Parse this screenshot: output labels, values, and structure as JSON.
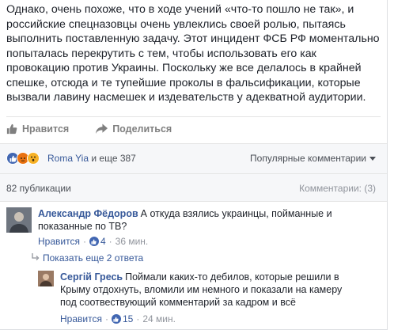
{
  "post": {
    "text": "Однако, очень похоже, что в ходе учений «что-то пошло не так», и российские спецназовцы очень увлеклись своей ролью, пытаясь выполнить поставленную задачу. Этот инцидент ФСБ РФ моментально попыталась перекрутить с тем, чтобы использовать его как провокацию против Украины. Поскольку же все делалось в крайней спешке, отсюда и те тупейшие проколы в фальсификации, которые вызвали лавину насмешек и издевательств у адекватной аудитории."
  },
  "actions": {
    "like_label": "Нравится",
    "share_label": "Поделиться"
  },
  "reactions": {
    "icons": [
      "like",
      "angry",
      "wow"
    ],
    "names_first": "Roma Yia",
    "names_rest": " и еще 387",
    "sort_label": "Популярные комментарии"
  },
  "comments_header": {
    "pubs": "82 публикации",
    "count_label": "Комментарии: (3)"
  },
  "comments": [
    {
      "author": "Александр Фёдоров",
      "text": "А откуда взялись украинцы, пойманные и показанные по ТВ?",
      "like_label": "Нравится",
      "likes": "4",
      "sep": "·",
      "time": "36 мин."
    }
  ],
  "more_replies": "Показать еще 2 ответа",
  "reply": {
    "author": "Сергій Гресь",
    "text": "Поймали каких-то дебилов, которые решили в Крыму отдохнуть, вломили им немного и показали на камеру под соотвествующий комментарий за кадром и всё",
    "like_label": "Нравится",
    "likes": "15",
    "sep": "·",
    "time": "24 мин."
  },
  "colors": {
    "link": "#365899",
    "like_blue": "#4267b2",
    "meta_gray": "#90949c",
    "bar_bg": "#f6f7f9"
  }
}
